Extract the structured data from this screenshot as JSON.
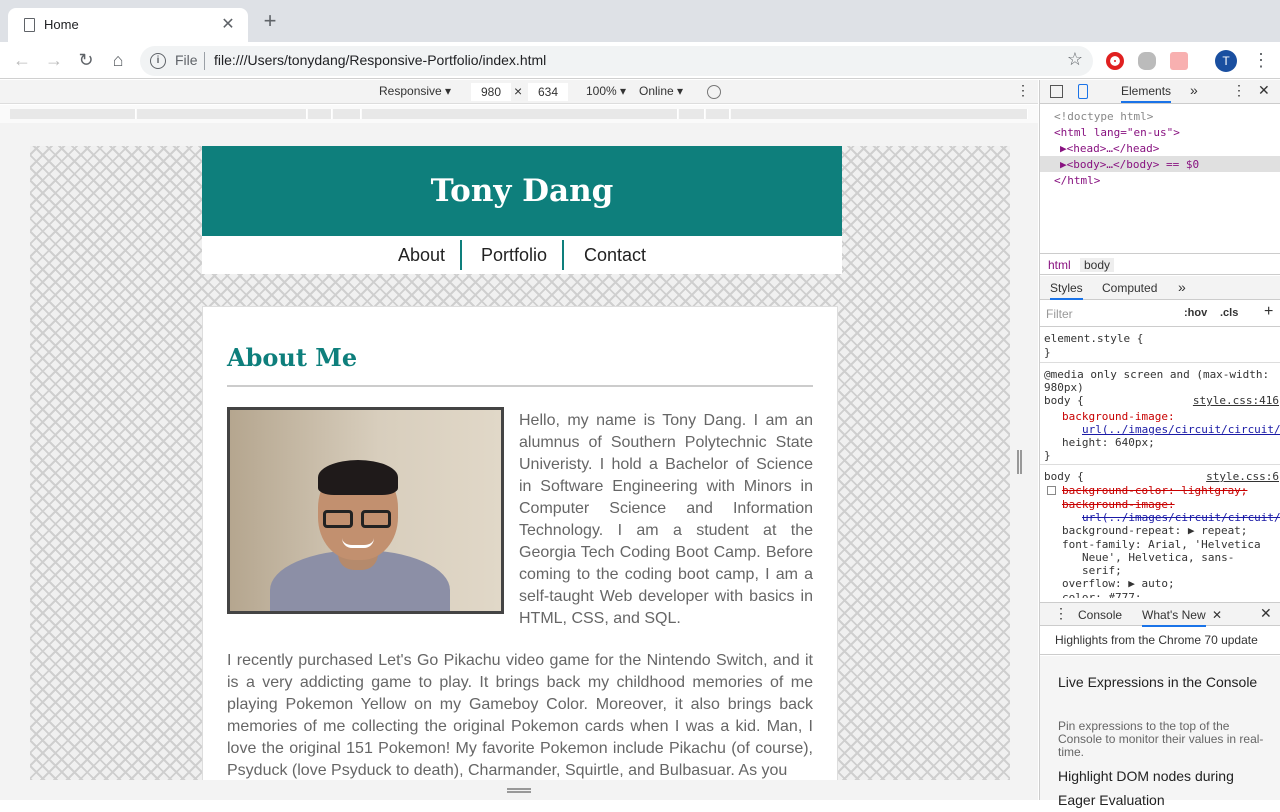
{
  "browser": {
    "tab_title": "Home",
    "scheme_label": "File",
    "url": "file:///Users/tonydang/Responsive-Portfolio/index.html",
    "avatar_letter": "T"
  },
  "device_toolbar": {
    "mode": "Responsive ▾",
    "width": "980",
    "times": "×",
    "height": "634",
    "zoom": "100% ▾",
    "network": "Online ▾"
  },
  "page": {
    "site_title": "Tony Dang",
    "nav": [
      "About",
      "Portfolio",
      "Contact"
    ],
    "section_title": "About Me",
    "intro": "Hello, my name is Tony Dang. I am an alumnus of Southern Polytechnic State Univeristy. I hold a Bachelor of Science in Software Engineering with Minors in Computer Science and Information Technology. I am a student at the Georgia Tech Coding Boot Camp. Before coming to the coding boot camp, I am a self-taught Web developer with basics in HTML, CSS, and SQL.",
    "para2": "I recently purchased Let's Go Pikachu video game for the Nintendo Switch, and it is a very addicting game to play. It brings back my childhood memories of me playing Pokemon Yellow on my Gameboy Color. Moreover, it also brings back memories of me collecting the original Pokemon cards when I was a kid. Man, I love the original 151 Pokemon! My favorite Pokemon include Pikachu (of course), Psyduck (love Psyduck to death), Charmander, Squirtle, and Bulbasuar. As you"
  },
  "devtools": {
    "tab_elements": "Elements",
    "dom": {
      "doctype": "<!doctype html>",
      "html_open": "<html lang=\"en-us\">",
      "head": "▶<head>…</head>",
      "body": "▶<body>…</body> == $0",
      "html_close": "</html>"
    },
    "crumbs": [
      "html",
      "body"
    ],
    "style_tabs": [
      "Styles",
      "Computed",
      "»"
    ],
    "filter_placeholder": "Filter",
    "hov": ":hov",
    "cls": ".cls",
    "styles": {
      "element_style": "element.style {",
      "close": "}",
      "media": "@media only screen and (max-width:",
      "media2": "980px)",
      "body_rule": "body {",
      "link1": "style.css:416",
      "bg_img": "background-image:",
      "bg_url": "url(../images/circuit/circuit/",
      "height": "height: 640px;",
      "link2": "style.css:6",
      "bg_color": "background-color: lightgray;",
      "bg_img2": "background-image:",
      "bg_url2": "url(../images/circuit/circuit/",
      "bg_repeat": "background-repeat: ▶ repeat;",
      "font_family": "font-family: Arial, 'Helvetica",
      "font_family2": "Neue', Helvetica, sans-",
      "font_family3": "serif;",
      "overflow": "overflow: ▶ auto;",
      "color": "color: #777;"
    },
    "drawer_tabs": [
      "Console",
      "What's New"
    ],
    "highlights": "Highlights from the Chrome 70 update",
    "whatsnew": {
      "h1": "Live Expressions in the Console",
      "d1": "Pin expressions to the top of the Console to monitor their values in real-time.",
      "h2": "Highlight DOM nodes during Eager Evaluation"
    }
  }
}
